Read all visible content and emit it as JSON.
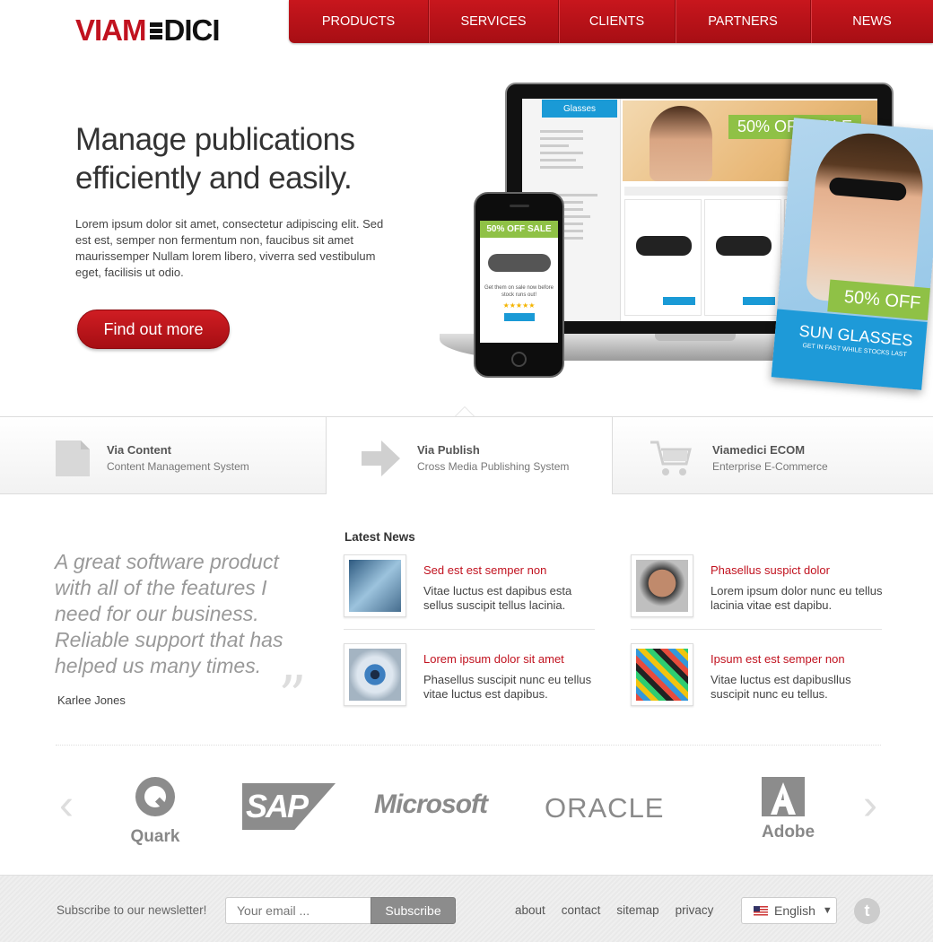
{
  "brand": {
    "logo_left": "VIAM",
    "logo_right": "DICI"
  },
  "nav": {
    "items": [
      "PRODUCTS",
      "SERVICES",
      "CLIENTS",
      "PARTNERS",
      "NEWS"
    ]
  },
  "hero": {
    "title": "Manage publications efficiently and easily.",
    "text": "Lorem ipsum dolor sit amet, consectetur adipiscing elit. Sed est est, semper non fermentum non, faucibus sit amet maurissemper Nullam lorem libero, viverra sed vestibulum eget, facilisis ut odio.",
    "cta": "Find out more",
    "laptop": {
      "tab": "Glasses",
      "banner": "50% OFF SALE"
    },
    "phone": {
      "tag": "50% OFF SALE",
      "text": "Get them on sale now before stock runs out!"
    },
    "ad": {
      "off": "50% OFF",
      "headline": "SUN GLASSES",
      "sub": "GET IN FAST WHILE STOCKS LAST"
    }
  },
  "products": [
    {
      "title": "Via Content",
      "subtitle": "Content Management System",
      "icon": "document-icon"
    },
    {
      "title": "Via Publish",
      "subtitle": "Cross Media Publishing System",
      "icon": "arrow-right-icon"
    },
    {
      "title": "Viamedici ECOM",
      "subtitle": "Enterprise E-Commerce",
      "icon": "shopping-cart-icon"
    }
  ],
  "testimonial": {
    "quote": "A great software product with all of the features I need for our business. Reliable support that has helped us many times.",
    "author": "Karlee Jones",
    "mark": "”"
  },
  "news": {
    "heading": "Latest News",
    "items": [
      {
        "title": "Sed est est semper non",
        "text": "Vitae luctus est dapibus esta sellus suscipit tellus lacinia."
      },
      {
        "title": "Phasellus suspict dolor",
        "text": "Lorem ipsum dolor nunc eu tellus lacinia vitae est dapibu."
      },
      {
        "title": "Lorem ipsum dolor sit amet",
        "text": "Phasellus suscipit nunc eu tellus vitae luctus est dapibus."
      },
      {
        "title": "Ipsum est est semper non",
        "text": "Vitae luctus est dapibusllus suscipit nunc eu tellus."
      }
    ]
  },
  "partners": {
    "logos": [
      "Quark",
      "SAP",
      "Microsoft",
      "ORACLE",
      "Adobe"
    ],
    "prev": "‹",
    "next": "›"
  },
  "footer": {
    "newsletter_label": "Subscribe to our newsletter!",
    "email_placeholder": "Your email ...",
    "subscribe": "Subscribe",
    "links": [
      "about",
      "contact",
      "sitemap",
      "privacy"
    ],
    "language": "English",
    "caret": "▼",
    "twitter": "t"
  },
  "colors": {
    "accent": "#c1121f",
    "blue": "#1a9ad6",
    "green": "#8fc146"
  }
}
